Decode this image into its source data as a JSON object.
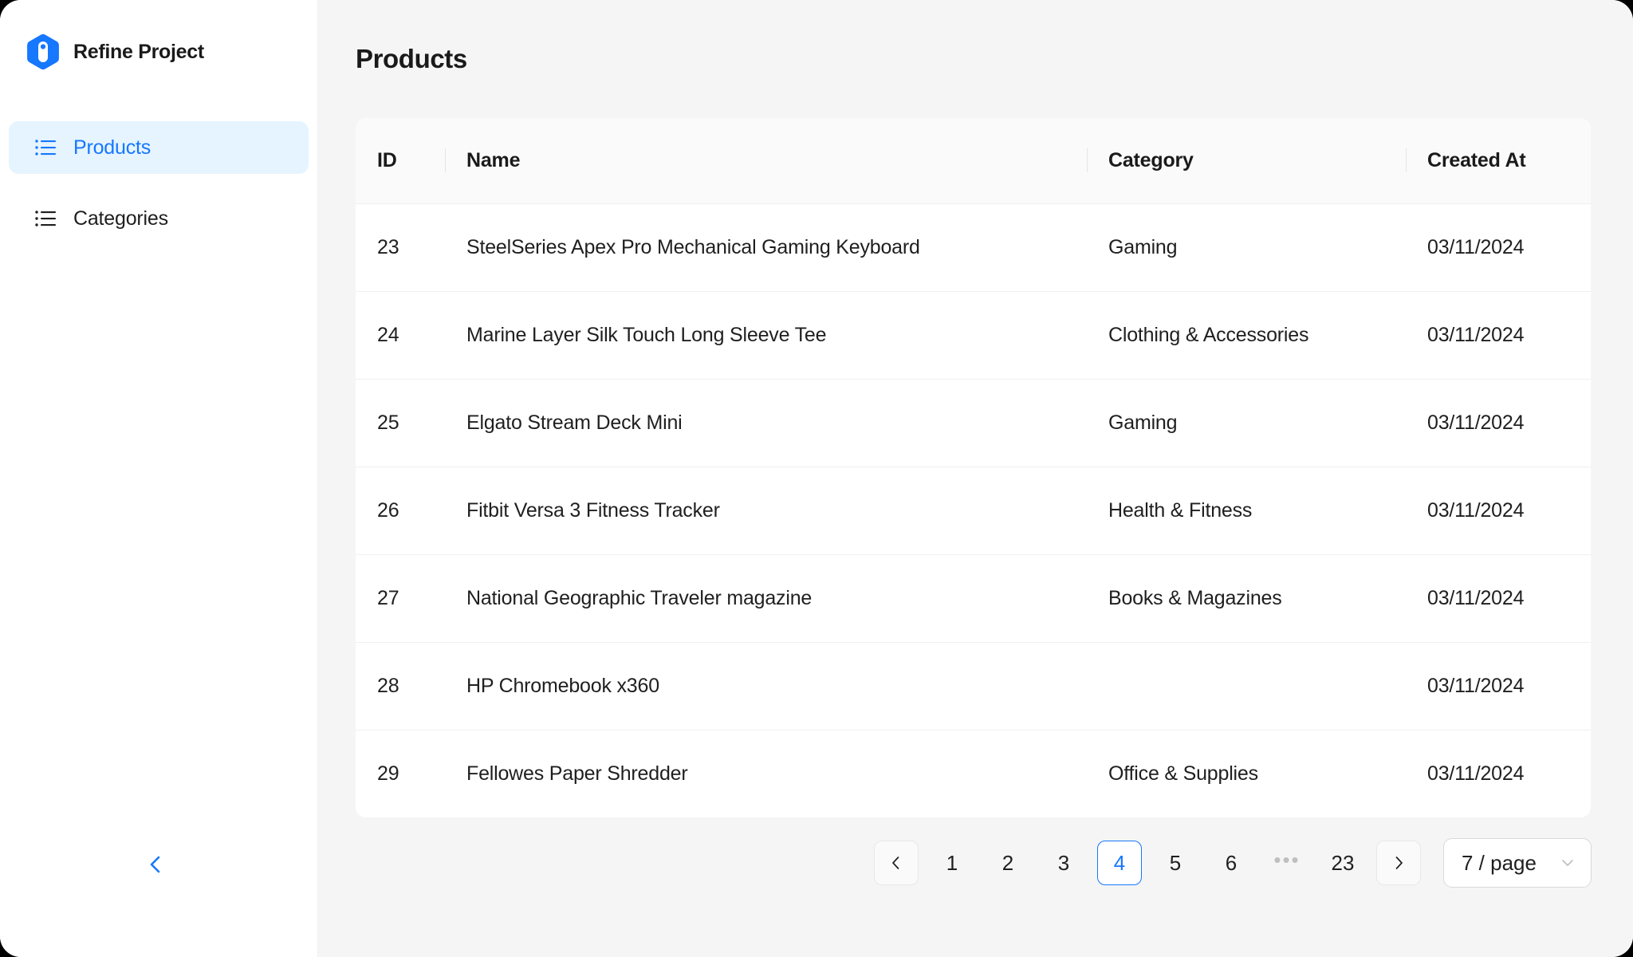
{
  "app": {
    "brand_title": "Refine Project",
    "logo_icon": "refine-hexagon-logo"
  },
  "sidebar": {
    "items": [
      {
        "label": "Products",
        "icon": "list-icon",
        "active": true
      },
      {
        "label": "Categories",
        "icon": "list-icon",
        "active": false
      }
    ],
    "collapse_icon": "chevron-left-icon",
    "accent_color": "#1677ff",
    "active_bg_color": "#e6f4ff"
  },
  "main": {
    "page_title": "Products",
    "background_color": "#f5f5f5"
  },
  "table": {
    "columns": [
      {
        "key": "id",
        "label": "ID"
      },
      {
        "key": "name",
        "label": "Name"
      },
      {
        "key": "category",
        "label": "Category"
      },
      {
        "key": "created_at",
        "label": "Created At"
      }
    ],
    "rows": [
      {
        "id": "23",
        "name": "SteelSeries Apex Pro Mechanical Gaming Keyboard",
        "category": "Gaming",
        "created_at": "03/11/2024"
      },
      {
        "id": "24",
        "name": "Marine Layer Silk Touch Long Sleeve Tee",
        "category": "Clothing & Accessories",
        "created_at": "03/11/2024"
      },
      {
        "id": "25",
        "name": "Elgato Stream Deck Mini",
        "category": "Gaming",
        "created_at": "03/11/2024"
      },
      {
        "id": "26",
        "name": "Fitbit Versa 3 Fitness Tracker",
        "category": "Health & Fitness",
        "created_at": "03/11/2024"
      },
      {
        "id": "27",
        "name": "National Geographic Traveler magazine",
        "category": "Books & Magazines",
        "created_at": "03/11/2024"
      },
      {
        "id": "28",
        "name": "HP Chromebook x360",
        "category": "",
        "created_at": "03/11/2024"
      },
      {
        "id": "29",
        "name": "Fellowes Paper Shredder",
        "category": "Office & Supplies",
        "created_at": "03/11/2024"
      }
    ]
  },
  "pagination": {
    "prev_icon": "chevron-left-icon",
    "next_icon": "chevron-right-icon",
    "pages": [
      "1",
      "2",
      "3",
      "4",
      "5",
      "6"
    ],
    "ellipsis": "•••",
    "last_page": "23",
    "current_page": "4",
    "page_size_label": "7 / page",
    "page_size_icon": "chevron-down-icon"
  }
}
